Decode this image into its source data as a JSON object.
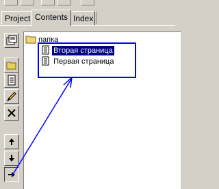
{
  "tabs": [
    {
      "label": "Project"
    },
    {
      "label": "Contents"
    },
    {
      "label": "Index"
    }
  ],
  "tree": {
    "folder": "папка",
    "pages": [
      {
        "label": "Вторая страница",
        "selected": true
      },
      {
        "label": "Первая страница",
        "selected": false
      }
    ]
  },
  "toolbar_icons": [
    "properties-icon",
    "folder-icon",
    "page-icon",
    "pencil-icon",
    "delete-icon",
    "move-up-icon",
    "move-down-icon",
    "move-right-icon"
  ],
  "colors": {
    "selection": "#000080",
    "annotation": "#0000ff"
  }
}
